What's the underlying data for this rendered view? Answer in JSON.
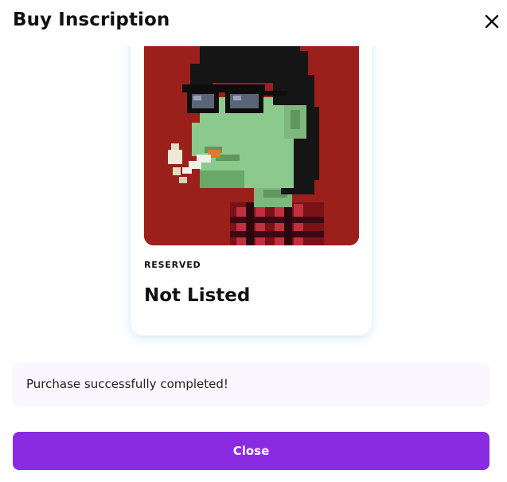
{
  "dialog": {
    "title": "Buy Inscription",
    "close_icon": "close-icon"
  },
  "inscription": {
    "status_label": "RESERVED",
    "listing_status": "Not Listed",
    "image_icon": "pixel-art-avatar"
  },
  "message": {
    "text": "Purchase successfully completed!"
  },
  "actions": {
    "close_label": "Close"
  },
  "colors": {
    "accent": "#8a2be2",
    "art_background": "#9b1f1a",
    "message_background": "#fbf6ff"
  }
}
